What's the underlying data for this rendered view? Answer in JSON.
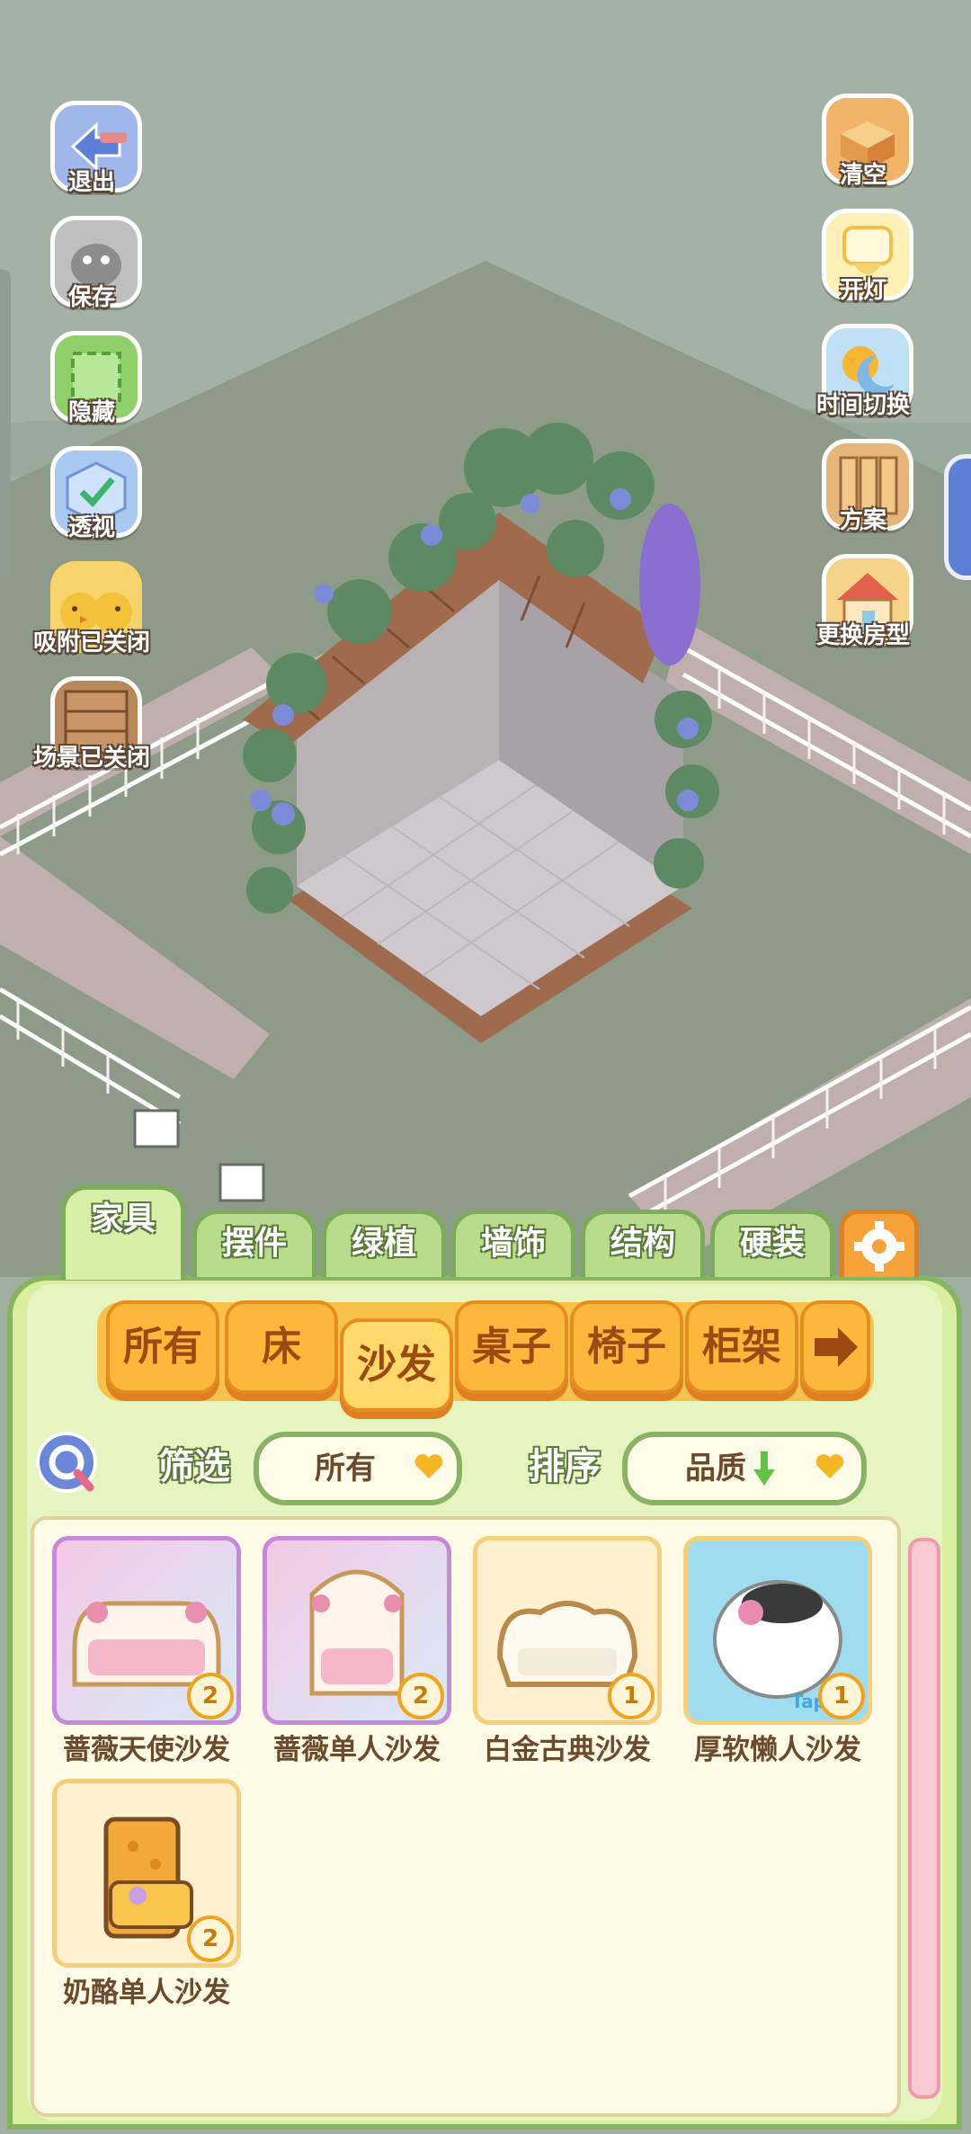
{
  "colors": {
    "sky": "#a3b2a4",
    "ground": "#8f9d88",
    "panel": "#e4f3b8",
    "panel_border": "#86b45f",
    "accent": "#fbb93c"
  },
  "left_buttons": [
    {
      "label": "退出",
      "icon": "exit-arrow-icon"
    },
    {
      "label": "保存",
      "icon": "save-icon"
    },
    {
      "label": "隐藏",
      "icon": "hide-frame-icon"
    },
    {
      "label": "透视",
      "icon": "perspective-cube-icon"
    },
    {
      "label": "吸附已关闭",
      "icon": "snap-chicks-icon"
    },
    {
      "label": "场景已关闭",
      "icon": "scene-crate-icon"
    }
  ],
  "right_buttons": [
    {
      "label": "清空",
      "icon": "clear-box-icon"
    },
    {
      "label": "开灯",
      "icon": "lamp-icon"
    },
    {
      "label": "时间切换",
      "icon": "sun-moon-icon"
    },
    {
      "label": "方案",
      "icon": "plan-books-icon"
    },
    {
      "label": "更换房型",
      "icon": "house-icon"
    }
  ],
  "tabs": [
    "家具",
    "摆件",
    "绿植",
    "墙饰",
    "结构",
    "硬装"
  ],
  "settings_icon": "gear-icon",
  "categories": [
    "所有",
    "床",
    "沙发",
    "桌子",
    "椅子",
    "柜架"
  ],
  "active_category": "沙发",
  "next_icon": "arrow-right-icon",
  "filter": {
    "label": "筛选",
    "value": "所有"
  },
  "sort": {
    "label": "排序",
    "value": "品质"
  },
  "items": [
    {
      "name": "蔷薇天使沙发",
      "count": "2",
      "frame": "purple"
    },
    {
      "name": "蔷薇单人沙发",
      "count": "2",
      "frame": "purple"
    },
    {
      "name": "白金古典沙发",
      "count": "1",
      "frame": "gold"
    },
    {
      "name": "厚软懒人沙发",
      "count": "1",
      "frame": "blue"
    },
    {
      "name": "奶酪单人沙发",
      "count": "2",
      "frame": "gold"
    }
  ],
  "watermark": "TapTap"
}
